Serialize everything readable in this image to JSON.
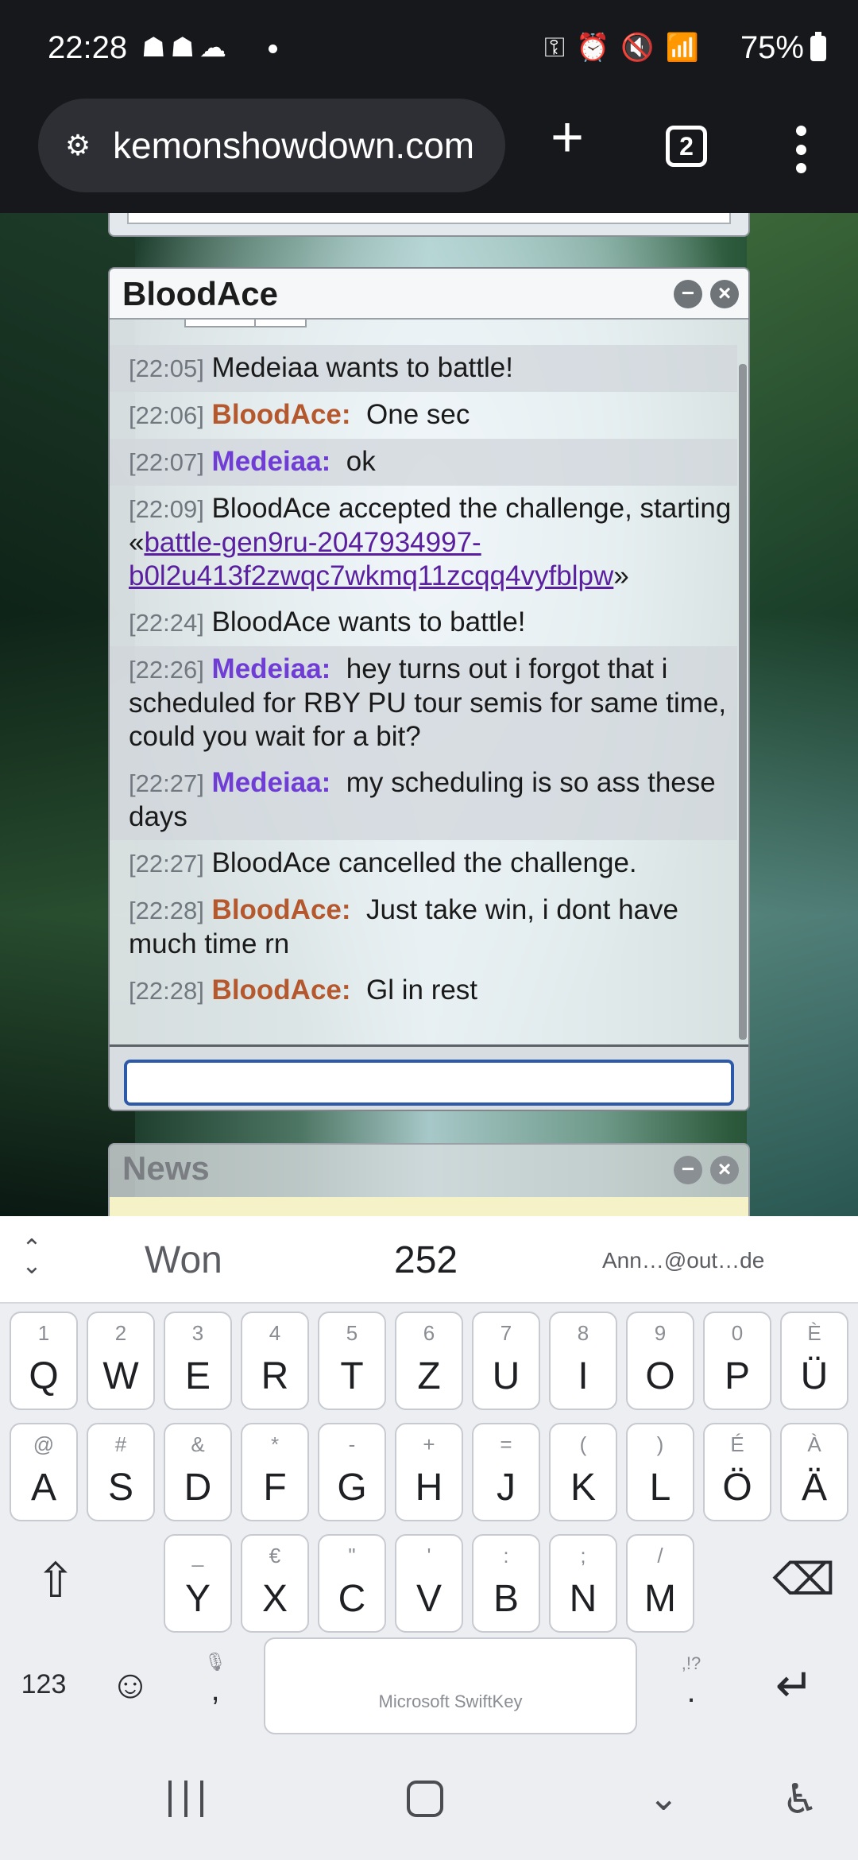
{
  "status_bar": {
    "time": "22:28",
    "battery": "75%",
    "left_icons": [
      "pokemon-icon",
      "pokemon-icon",
      "cloud-icon",
      "dot-icon"
    ],
    "right_icons": [
      "vpn-key-icon",
      "alarm-icon",
      "mute-icon",
      "wifi-icon",
      "signal-icon",
      "battery-icon"
    ]
  },
  "browser": {
    "url": "κkemonshowdown.com",
    "url_display": "kemonshowdown.com",
    "tab_count": "2",
    "plus_label": "+"
  },
  "pm_window": {
    "title": "BloodAce",
    "minimize_glyph": "−",
    "close_glyph": "×",
    "messages": [
      {
        "time": "[22:05]",
        "user": "",
        "text": "Medeiaa wants to battle!"
      },
      {
        "time": "[22:06]",
        "user": "BloodAce:",
        "text": "One sec"
      },
      {
        "time": "[22:07]",
        "user": "Medeiaa:",
        "text": "ok"
      },
      {
        "time": "[22:09]",
        "user": "",
        "text_before": "BloodAce accepted the challenge, starting «",
        "link": "battle-gen9ru-2047934997-b0l2u413f2zwqc7wkmq11zcqq4vyfblpw",
        "text_after": "»"
      },
      {
        "time": "[22:24]",
        "user": "",
        "text": "BloodAce wants to battle!"
      },
      {
        "time": "[22:26]",
        "user": "Medeiaa:",
        "text": "hey turns out i forgot that i scheduled for RBY PU tour semis for same time, could you wait for a bit?"
      },
      {
        "time": "[22:27]",
        "user": "Medeiaa:",
        "text": "my scheduling is so ass these days"
      },
      {
        "time": "[22:27]",
        "user": "",
        "text": "BloodAce cancelled the challenge."
      },
      {
        "time": "[22:28]",
        "user": "BloodAce:",
        "text": "Just take win, i dont have much time rn"
      },
      {
        "time": "[22:28]",
        "user": "BloodAce:",
        "text": "Gl in rest"
      }
    ],
    "input_value": ""
  },
  "news_window": {
    "title": "News"
  },
  "keyboard": {
    "suggestions": [
      "Won",
      "252",
      "Ann…@out…de"
    ],
    "row1": [
      {
        "hint": "1",
        "main": "Q"
      },
      {
        "hint": "2",
        "main": "W"
      },
      {
        "hint": "3",
        "main": "E"
      },
      {
        "hint": "4",
        "main": "R"
      },
      {
        "hint": "5",
        "main": "T"
      },
      {
        "hint": "6",
        "main": "Z"
      },
      {
        "hint": "7",
        "main": "U"
      },
      {
        "hint": "8",
        "main": "I"
      },
      {
        "hint": "9",
        "main": "O"
      },
      {
        "hint": "0",
        "main": "P"
      },
      {
        "hint": "È",
        "main": "Ü"
      }
    ],
    "row2": [
      {
        "hint": "@",
        "main": "A"
      },
      {
        "hint": "#",
        "main": "S"
      },
      {
        "hint": "&",
        "main": "D"
      },
      {
        "hint": "*",
        "main": "F"
      },
      {
        "hint": "-",
        "main": "G"
      },
      {
        "hint": "+",
        "main": "H"
      },
      {
        "hint": "=",
        "main": "J"
      },
      {
        "hint": "(",
        "main": "K"
      },
      {
        "hint": ")",
        "main": "L"
      },
      {
        "hint": "É",
        "main": "Ö"
      },
      {
        "hint": "À",
        "main": "Ä"
      }
    ],
    "row3": [
      {
        "hint": "_",
        "main": "Y"
      },
      {
        "hint": "€",
        "main": "X"
      },
      {
        "hint": "\"",
        "main": "C"
      },
      {
        "hint": "'",
        "main": "V"
      },
      {
        "hint": ":",
        "main": "B"
      },
      {
        "hint": ";",
        "main": "N"
      },
      {
        "hint": "/",
        "main": "M"
      }
    ],
    "numbers_label": "123",
    "comma_label": ",",
    "period_label": ".",
    "period_hint": ",!?",
    "space_label": "Microsoft SwiftKey"
  }
}
